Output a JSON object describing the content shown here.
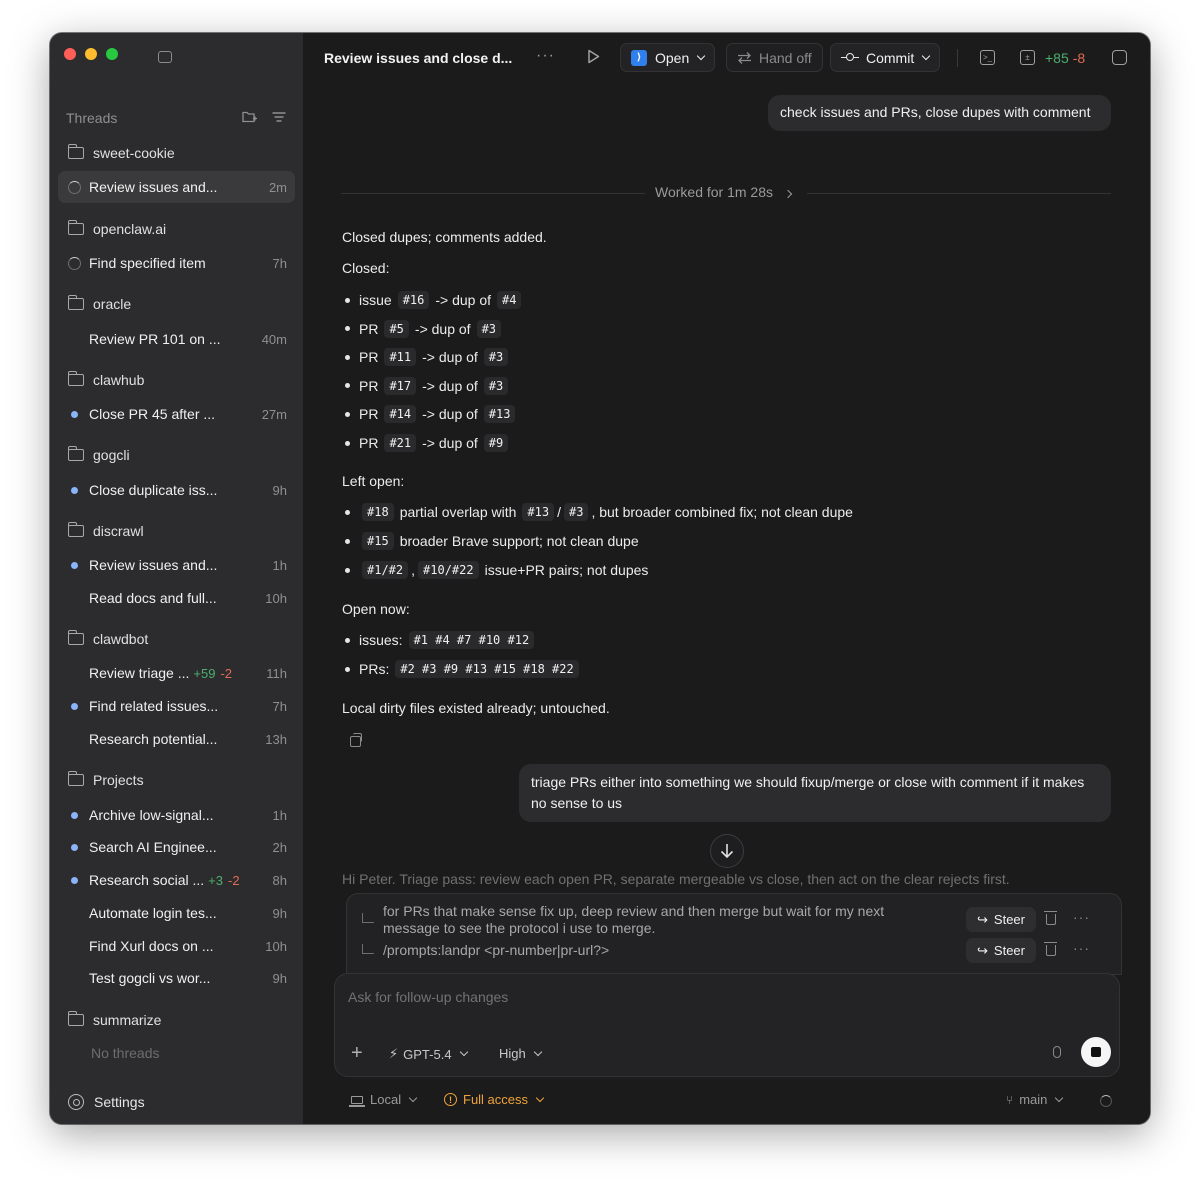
{
  "sidebar": {
    "threads_label": "Threads",
    "settings_label": "Settings",
    "groups": [
      {
        "name": "sweet-cookie",
        "threads": [
          {
            "title": "Review issues and...",
            "time": "2m",
            "status": "running",
            "active": true
          }
        ]
      },
      {
        "name": "openclaw.ai",
        "threads": [
          {
            "title": "Find specified item",
            "time": "7h",
            "status": "running"
          }
        ]
      },
      {
        "name": "oracle",
        "threads": [
          {
            "title": "Review PR 101 on ...",
            "time": "40m",
            "status": "none"
          }
        ]
      },
      {
        "name": "clawhub",
        "threads": [
          {
            "title": "Close PR 45 after ...",
            "time": "27m",
            "status": "unread"
          }
        ]
      },
      {
        "name": "gogcli",
        "threads": [
          {
            "title": "Close duplicate iss...",
            "time": "9h",
            "status": "unread"
          }
        ]
      },
      {
        "name": "discrawl",
        "threads": [
          {
            "title": "Review issues and...",
            "time": "1h",
            "status": "unread"
          },
          {
            "title": "Read docs and full...",
            "time": "10h",
            "status": "none"
          }
        ]
      },
      {
        "name": "clawdbot",
        "threads": [
          {
            "title": "Review triage ...",
            "time": "11h",
            "status": "none",
            "plus": "+59",
            "minus": "-2"
          },
          {
            "title": "Find related issues...",
            "time": "7h",
            "status": "unread"
          },
          {
            "title": "Research potential...",
            "time": "13h",
            "status": "none"
          }
        ]
      },
      {
        "name": "Projects",
        "threads": [
          {
            "title": "Archive low-signal...",
            "time": "1h",
            "status": "unread"
          },
          {
            "title": "Search AI Enginee...",
            "time": "2h",
            "status": "unread"
          },
          {
            "title": "Research social ...",
            "time": "8h",
            "status": "unread",
            "plus": "+3",
            "minus": "-2"
          },
          {
            "title": "Automate login tes...",
            "time": "9h",
            "status": "none"
          },
          {
            "title": "Find Xurl docs on ...",
            "time": "10h",
            "status": "none"
          },
          {
            "title": "Test gogcli vs wor...",
            "time": "9h",
            "status": "none"
          }
        ]
      },
      {
        "name": "summarize",
        "threads": [],
        "empty_label": "No threads"
      }
    ]
  },
  "toolbar": {
    "title": "Review issues and close d...",
    "more": "···",
    "open_label": "Open",
    "handoff_label": "Hand off",
    "commit_label": "Commit",
    "diff_plus": "+85",
    "diff_minus": "-8"
  },
  "conversation": {
    "user_msg_1": "check issues and PRs, close dupes with comment",
    "worked_for": "Worked for 1m 28s",
    "summary": "Closed dupes; comments added.",
    "closed_heading": "Closed:",
    "closed": [
      {
        "kind": "issue",
        "id": "#16",
        "sep": "-> dup of",
        "dup": "#4"
      },
      {
        "kind": "PR",
        "id": "#5",
        "sep": "-> dup of",
        "dup": "#3"
      },
      {
        "kind": "PR",
        "id": "#11",
        "sep": "-> dup of",
        "dup": "#3"
      },
      {
        "kind": "PR",
        "id": "#17",
        "sep": "-> dup of",
        "dup": "#3"
      },
      {
        "kind": "PR",
        "id": "#14",
        "sep": "-> dup of",
        "dup": "#13"
      },
      {
        "kind": "PR",
        "id": "#21",
        "sep": "-> dup of",
        "dup": "#9"
      }
    ],
    "left_open_heading": "Left open:",
    "left_open": {
      "l1": {
        "a": "#18",
        "t1": "partial overlap with",
        "b": "#13",
        "slash": "/",
        "c": "#3",
        "t2": ", but broader combined fix; not clean dupe"
      },
      "l2": {
        "a": "#15",
        "t1": "broader Brave support; not clean dupe"
      },
      "l3": {
        "a": "#1/#2",
        "comma": ",",
        "b": "#10/#22",
        "t1": "issue+PR pairs; not dupes"
      }
    },
    "open_now_heading": "Open now:",
    "open_issues_label": "issues:",
    "open_issues": "#1 #4 #7 #10 #12",
    "open_prs_label": "PRs:",
    "open_prs": "#2 #3 #9 #13 #15 #18 #22",
    "local_note": "Local dirty files existed already; untouched.",
    "user_msg_2": "triage PRs either into something we should fixup/merge or close with comment if it makes no sense to us",
    "assistant_stream": "Hi Peter. Triage pass: review each open PR, separate mergeable vs close, then act on the clear rejects first."
  },
  "queue": [
    {
      "text": "for PRs that make sense fix up, deep review and then merge but wait for my next message to see the protocol i use to merge.",
      "steer": "Steer"
    },
    {
      "text": "/prompts:landpr <pr-number|pr-url?>",
      "steer": "Steer"
    }
  ],
  "composer": {
    "placeholder": "Ask for follow-up changes",
    "model": "GPT-5.4",
    "effort": "High"
  },
  "footer": {
    "env": "Local",
    "access": "Full access",
    "branch": "main"
  },
  "colors": {
    "accent_blue": "#8ab4f8",
    "diff_green": "#4caf6d",
    "diff_red": "#e06b54",
    "warning_orange": "#f0a33a"
  }
}
